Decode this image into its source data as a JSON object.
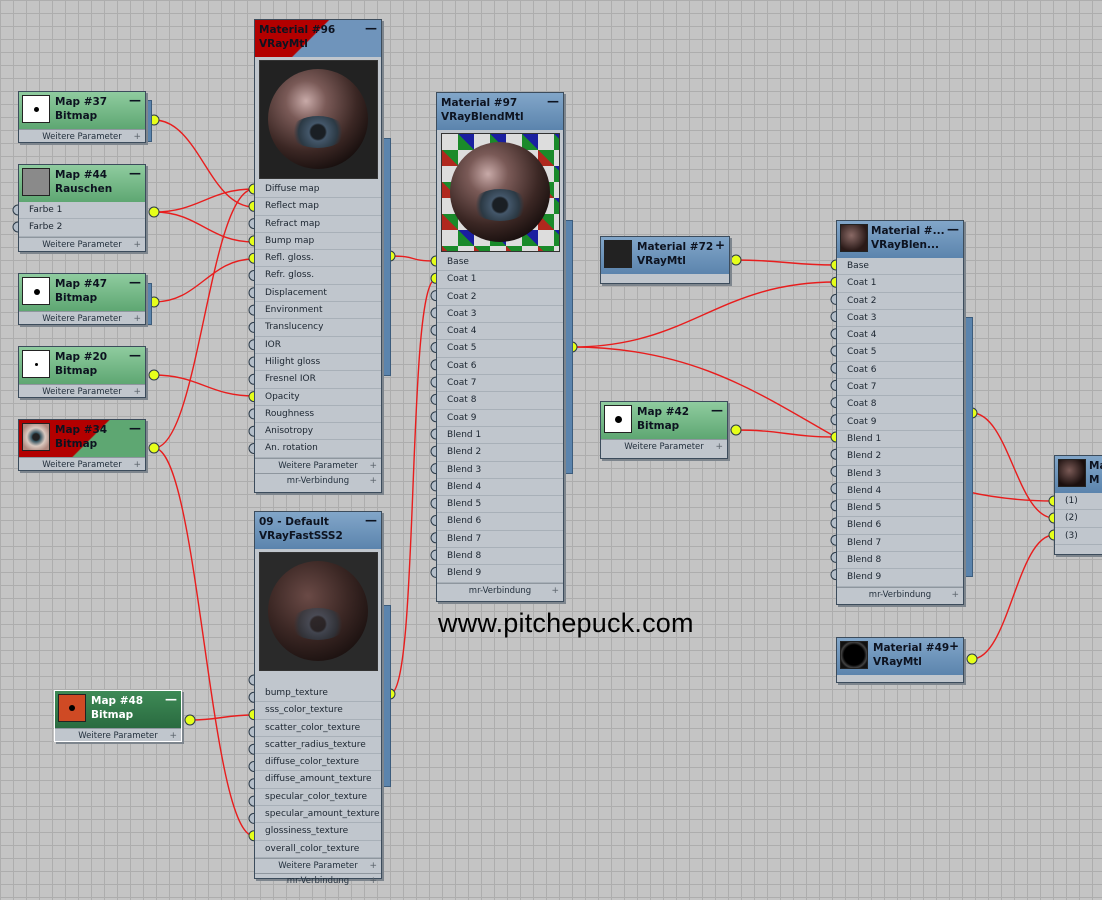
{
  "colors": {
    "wire": "#e81d1d",
    "socket_active": "#e6ff1a",
    "socket_idle": "#b4bec9",
    "material_header": "#6f94bb",
    "map_header": "#6fb683"
  },
  "nodes": {
    "m96": {
      "title": "Material #96",
      "type": "VRayMtl",
      "sockets": [
        "Diffuse map",
        "Reflect map",
        "Refract map",
        "Bump map",
        "Refl. gloss.",
        "Refr. gloss.",
        "Displacement",
        "Environment",
        "Translucency",
        "IOR",
        "Hilight gloss",
        "Fresnel IOR",
        "Opacity",
        "Roughness",
        "Anisotropy",
        "An. rotation"
      ],
      "footers": [
        "Weitere Parameter",
        "mr-Verbindung"
      ]
    },
    "m97": {
      "title": "Material #97",
      "type": "VRayBlendMtl",
      "sockets": [
        "Base",
        "Coat 1",
        "Coat 2",
        "Coat 3",
        "Coat 4",
        "Coat 5",
        "Coat 6",
        "Coat 7",
        "Coat 8",
        "Coat 9",
        "Blend 1",
        "Blend 2",
        "Blend 3",
        "Blend 4",
        "Blend 5",
        "Blend 6",
        "Blend 7",
        "Blend 8",
        "Blend 9"
      ],
      "footers": [
        "mr-Verbindung"
      ]
    },
    "sss": {
      "title": "09 - Default",
      "type": "VRayFastSSS2",
      "sockets": [
        "bump_texture",
        "sss_color_texture",
        "scatter_color_texture",
        "scatter_radius_texture",
        "diffuse_color_texture",
        "diffuse_amount_texture",
        "specular_color_texture",
        "specular_amount_texture",
        "glossiness_texture",
        "overall_color_texture"
      ],
      "footers": [
        "Weitere Parameter",
        "mr-Verbindung"
      ]
    },
    "mblend": {
      "title": "Material #...",
      "type": "VRayBlen...",
      "sockets": [
        "Base",
        "Coat 1",
        "Coat 2",
        "Coat 3",
        "Coat 4",
        "Coat 5",
        "Coat 6",
        "Coat 7",
        "Coat 8",
        "Coat 9",
        "Blend 1",
        "Blend 2",
        "Blend 3",
        "Blend 4",
        "Blend 5",
        "Blend 6",
        "Blend 7",
        "Blend 8",
        "Blend 9"
      ],
      "footers": [
        "mr-Verbindung"
      ]
    },
    "m72": {
      "title": "Material #72",
      "type": "VRayMtl"
    },
    "m49": {
      "title": "Material #49",
      "type": "VRayMtl"
    },
    "mright": {
      "title": "Ma",
      "type": "M",
      "sockets": [
        "(1)",
        "(2)",
        "(3)"
      ]
    },
    "map37": {
      "title": "Map #37",
      "type": "Bitmap",
      "footer": "Weitere Parameter"
    },
    "map44": {
      "title": "Map #44",
      "type": "Rauschen",
      "sockets": [
        "Farbe 1",
        "Farbe 2"
      ],
      "footer": "Weitere Parameter"
    },
    "map47": {
      "title": "Map #47",
      "type": "Bitmap",
      "footer": "Weitere Parameter"
    },
    "map20": {
      "title": "Map #20",
      "type": "Bitmap",
      "footer": "Weitere Parameter"
    },
    "map34": {
      "title": "Map #34",
      "type": "Bitmap",
      "footer": "Weitere Parameter"
    },
    "map42": {
      "title": "Map #42",
      "type": "Bitmap",
      "footer": "Weitere Parameter"
    },
    "map48": {
      "title": "Map #48",
      "type": "Bitmap",
      "footer": "Weitere Parameter"
    }
  },
  "watermark": "www.pitchepuck.com"
}
